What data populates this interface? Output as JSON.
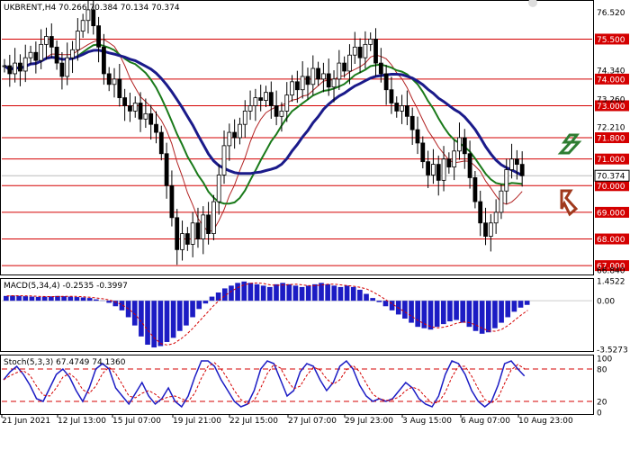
{
  "header": {
    "symbol_line": "UKBRENT,H4  70.266 70.384 70.134 70.374",
    "macd_line": "MACD(5,34,4) -0.2535 -0.3997",
    "stoch_line": "Stoch(5,3,3) 67.4749 74.1360"
  },
  "price_axis": {
    "ticks": [
      "76.920",
      "76.380",
      "75.840",
      "75.300",
      "74.760",
      "74.220",
      "73.680",
      "73.140",
      "72.600",
      "72.060",
      "71.520",
      "70.980",
      "70.440",
      "69.900",
      "69.360",
      "68.820",
      "68.280",
      "67.740",
      "67.200",
      "66.660"
    ],
    "visible_labels": [
      {
        "text": "76.520"
      },
      {
        "text": "74.340"
      },
      {
        "text": "73.260"
      },
      {
        "text": "72.210"
      },
      {
        "text": "66.840"
      }
    ],
    "levels": [
      {
        "text": "75.500"
      },
      {
        "text": "74.000"
      },
      {
        "text": "73.000"
      },
      {
        "text": "71.800"
      },
      {
        "text": "71.000"
      },
      {
        "text": "70.000"
      },
      {
        "text": "69.000"
      },
      {
        "text": "68.000"
      },
      {
        "text": "67.000"
      }
    ],
    "current_price": "70.374"
  },
  "macd_axis": {
    "labels": [
      "1.4522",
      "0.00",
      "-3.5273"
    ]
  },
  "stoch_axis": {
    "labels": [
      "100",
      "80",
      "20",
      "0"
    ]
  },
  "time_axis": {
    "labels": [
      "21 Jun 2021",
      "12 Jul 13:00",
      "15 Jul 07:00",
      "19 Jul 21:00",
      "22 Jul 15:00",
      "27 Jul 07:00",
      "29 Jul 23:00",
      "3 Aug 15:00",
      "6 Aug 07:00",
      "10 Aug 23:00"
    ]
  },
  "arrows": {
    "up_color": "#2e7d32",
    "down_color": "#a0391d"
  },
  "chart_data": {
    "type": "line",
    "title": "UKBRENT,H4",
    "price_levels": [
      75.5,
      74.0,
      73.0,
      71.8,
      71.0,
      70.0,
      69.0,
      68.0,
      67.0
    ],
    "current_price": 70.374,
    "ohlc_last": {
      "open": 70.266,
      "high": 70.384,
      "low": 70.134,
      "close": 70.374
    },
    "ylim": [
      66.7,
      76.9
    ],
    "close_series": [
      74.5,
      74.2,
      74.6,
      74.3,
      74.8,
      75.0,
      74.7,
      75.3,
      75.6,
      75.2,
      74.6,
      74.1,
      74.8,
      75.1,
      75.8,
      76.2,
      76.6,
      76.0,
      75.2,
      74.2,
      73.8,
      74.0,
      73.3,
      73.0,
      72.8,
      73.1,
      72.5,
      72.7,
      72.3,
      72.0,
      71.2,
      70.0,
      68.8,
      67.6,
      68.2,
      67.8,
      68.6,
      68.0,
      68.9,
      68.2,
      69.4,
      70.4,
      71.5,
      72.0,
      71.8,
      72.3,
      72.8,
      73.0,
      73.3,
      73.2,
      73.5,
      73.0,
      72.6,
      72.8,
      73.4,
      73.9,
      73.6,
      74.1,
      73.8,
      74.4,
      74.0,
      74.2,
      73.7,
      74.0,
      74.6,
      74.3,
      74.9,
      75.2,
      74.8,
      75.3,
      75.5,
      74.6,
      74.2,
      73.6,
      73.1,
      72.8,
      73.0,
      72.6,
      72.1,
      71.6,
      70.9,
      70.4,
      70.8,
      70.2,
      71.0,
      70.7,
      71.3,
      71.8,
      71.2,
      70.3,
      69.4,
      68.6,
      68.1,
      68.6,
      69.0,
      69.8,
      70.6,
      71.0,
      70.8,
      70.374
    ],
    "macd_hist": [
      0.35,
      0.38,
      0.36,
      0.33,
      0.3,
      0.28,
      0.3,
      0.32,
      0.35,
      0.33,
      0.3,
      0.27,
      0.24,
      0.2,
      0.1,
      0.02,
      -0.15,
      -0.4,
      -0.7,
      -1.2,
      -1.8,
      -2.6,
      -3.2,
      -3.4,
      -3.3,
      -3.0,
      -2.7,
      -2.2,
      -1.8,
      -1.2,
      -0.6,
      -0.2,
      0.3,
      0.6,
      0.9,
      1.1,
      1.3,
      1.4,
      1.3,
      1.2,
      1.1,
      1.0,
      1.2,
      1.3,
      1.2,
      1.1,
      1.0,
      1.1,
      1.2,
      1.3,
      1.2,
      1.1,
      1.0,
      1.1,
      1.0,
      0.8,
      0.5,
      0.2,
      -0.1,
      -0.4,
      -0.7,
      -1.0,
      -1.3,
      -1.6,
      -1.9,
      -2.0,
      -2.1,
      -1.9,
      -1.7,
      -1.5,
      -1.4,
      -1.6,
      -1.9,
      -2.2,
      -2.4,
      -2.3,
      -2.0,
      -1.6,
      -1.2,
      -0.8,
      -0.5,
      -0.3
    ],
    "stoch_main": [
      60,
      75,
      85,
      70,
      50,
      25,
      20,
      45,
      70,
      80,
      65,
      40,
      20,
      45,
      80,
      90,
      80,
      45,
      30,
      15,
      35,
      55,
      30,
      15,
      25,
      45,
      20,
      10,
      30,
      65,
      95,
      95,
      85,
      60,
      40,
      20,
      10,
      15,
      40,
      80,
      95,
      90,
      60,
      30,
      40,
      75,
      90,
      85,
      60,
      40,
      55,
      85,
      95,
      80,
      50,
      30,
      20,
      25,
      20,
      25,
      40,
      55,
      45,
      25,
      15,
      10,
      30,
      70,
      95,
      90,
      70,
      40,
      20,
      10,
      20,
      50,
      90,
      95,
      80,
      67
    ]
  }
}
